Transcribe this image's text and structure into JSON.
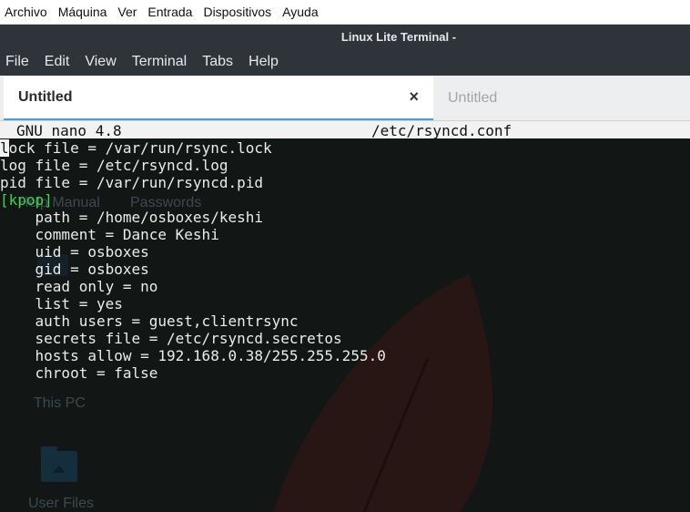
{
  "vbox_menu": [
    "Archivo",
    "Máquina",
    "Ver",
    "Entrada",
    "Dispositivos",
    "Ayuda"
  ],
  "window_title": "Linux Lite Terminal -",
  "terminal_menu": [
    "File",
    "Edit",
    "View",
    "Terminal",
    "Tabs",
    "Help"
  ],
  "tabs": {
    "active_label": "Untitled",
    "close_glyph": "×",
    "inactive_label": "Untitled"
  },
  "nano": {
    "version": "GNU nano 4.8",
    "filename": "/etc/rsyncd.conf",
    "cursor_char": "l",
    "first_line_rest": "ock file = /var/run/rsync.lock",
    "lines": [
      "log file = /etc/rsyncd.log",
      "pid file = /var/run/rsyncd.pid",
      "[kpop]",
      "    path = /home/osboxes/keshi",
      "    comment = Dance Keshi",
      "    uid = osboxes",
      "    gid = osboxes",
      "    read only = no",
      "    list = yes",
      "    auth users = guest,clientrsync",
      "    secrets file = /etc/rsyncd.secretos",
      "    hosts allow = 192.168.0.38/255.255.255.0",
      "    chroot = false"
    ]
  },
  "desktop_labels": {
    "help_manual": "Help Manual",
    "passwords": "Passwords",
    "this_pc": "This PC",
    "user_files": "User Files"
  },
  "colors": {
    "terminal_bg": "#121614",
    "section_green": "#3ed352",
    "tab_indicator": "#4b9be0",
    "titlebar_bg": "#2f343a"
  }
}
